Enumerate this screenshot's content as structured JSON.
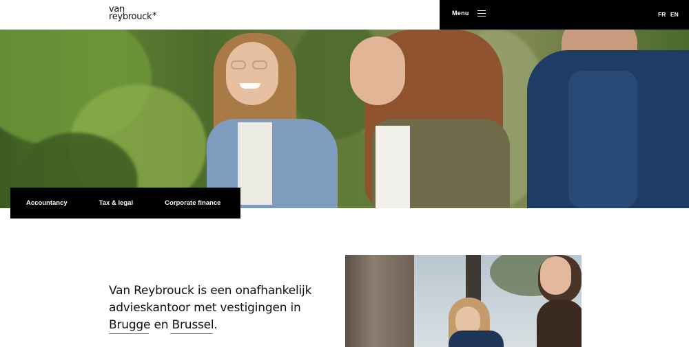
{
  "header": {
    "logo_line1": "van",
    "logo_line2": "reybrouck",
    "logo_star": "*",
    "menu_label": "Menu",
    "languages": [
      "FR",
      "EN"
    ]
  },
  "services": {
    "items": [
      "Accountancy",
      "Tax & legal",
      "Corporate finance"
    ]
  },
  "intro": {
    "text": "Van Reybrouck is een onafhankelijk advieskantoor met vestigingen in Brugge en Brussel."
  },
  "colors": {
    "black": "#000000",
    "white": "#ffffff",
    "text": "#111111"
  },
  "icons": {
    "menu": "hamburger-icon"
  }
}
